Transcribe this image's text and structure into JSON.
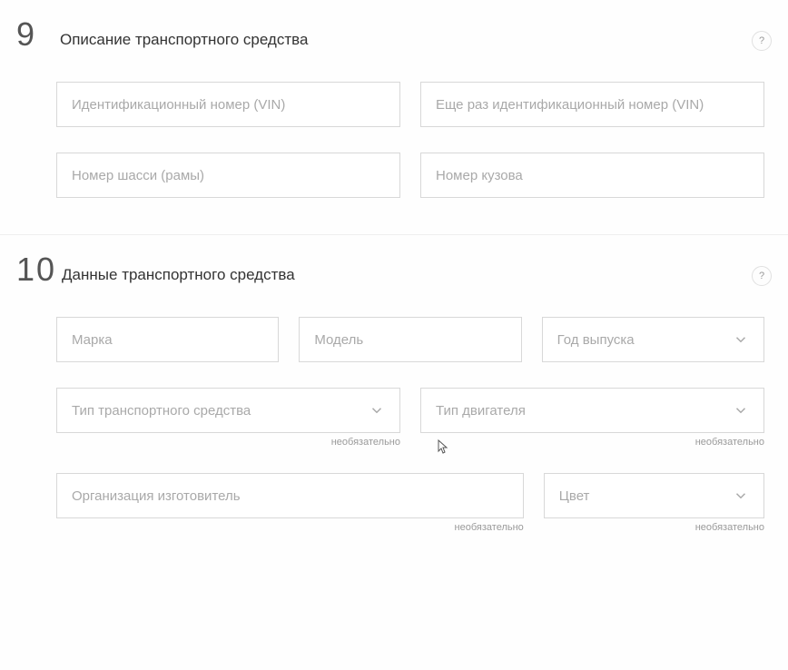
{
  "section9": {
    "number": "9",
    "title": "Описание транспортного средства",
    "help": "?",
    "fields": {
      "vin": {
        "placeholder": "Идентификационный номер (VIN)"
      },
      "vin2": {
        "placeholder": "Еще раз идентификационный номер (VIN)"
      },
      "chassis": {
        "placeholder": "Номер шасси (рамы)"
      },
      "body": {
        "placeholder": "Номер кузова"
      }
    }
  },
  "section10": {
    "number": "10",
    "title": "Данные транспортного средства",
    "help": "?",
    "fields": {
      "make": {
        "placeholder": "Марка"
      },
      "model": {
        "placeholder": "Модель"
      },
      "year": {
        "placeholder": "Год выпуска"
      },
      "vtype": {
        "placeholder": "Тип транспортного средства",
        "hint": "необязательно"
      },
      "engine": {
        "placeholder": "Тип двигателя",
        "hint": "необязательно"
      },
      "manufacturer": {
        "placeholder": "Организация изготовитель",
        "hint": "необязательно"
      },
      "color": {
        "placeholder": "Цвет",
        "hint": "необязательно"
      }
    }
  }
}
